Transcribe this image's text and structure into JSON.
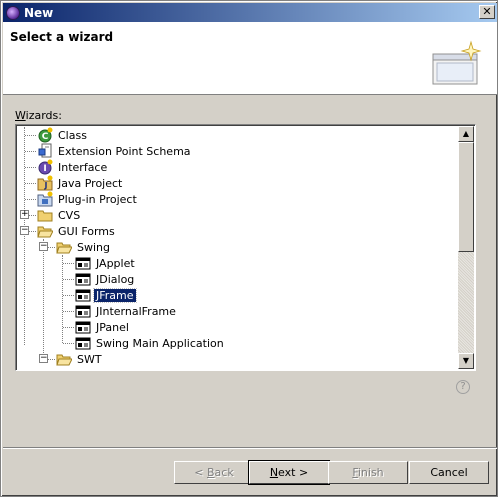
{
  "window": {
    "title": "New",
    "close_glyph": "✕"
  },
  "header": {
    "title": "Select a wizard"
  },
  "wizards_label": {
    "mnemonic": "W",
    "rest": "izards:"
  },
  "tree": [
    {
      "label": "Class",
      "icon": "class-icon",
      "selected": false
    },
    {
      "label": "Extension Point Schema",
      "icon": "extension-point-schema-icon",
      "selected": false
    },
    {
      "label": "Interface",
      "icon": "interface-icon",
      "selected": false
    },
    {
      "label": "Java Project",
      "icon": "java-project-icon",
      "selected": false
    },
    {
      "label": "Plug-in Project",
      "icon": "plugin-project-icon",
      "selected": false
    },
    {
      "label": "CVS",
      "icon": "folder-icon",
      "expander": "+",
      "selected": false
    },
    {
      "label": "GUI Forms",
      "icon": "folder-open-icon",
      "expander": "−",
      "selected": false
    },
    {
      "label": "Swing",
      "icon": "folder-open-icon",
      "expander": "−",
      "selected": false
    },
    {
      "label": "JApplet",
      "icon": "form-icon",
      "selected": false
    },
    {
      "label": "JDialog",
      "icon": "form-icon",
      "selected": false
    },
    {
      "label": "JFrame",
      "icon": "form-icon",
      "selected": true
    },
    {
      "label": "JInternalFrame",
      "icon": "form-icon",
      "selected": false
    },
    {
      "label": "JPanel",
      "icon": "form-icon",
      "selected": false
    },
    {
      "label": "Swing Main Application",
      "icon": "form-icon",
      "selected": false
    },
    {
      "label": "SWT",
      "icon": "folder-open-icon",
      "expander": "−",
      "selected": false
    }
  ],
  "scrollbar": {
    "up_glyph": "▲",
    "down_glyph": "▼"
  },
  "help": {
    "glyph": "?"
  },
  "buttons": {
    "back": {
      "prefix": "< ",
      "mnemonic": "B",
      "rest": "ack"
    },
    "next": {
      "mnemonic": "N",
      "rest": "ext >"
    },
    "finish": {
      "mnemonic": "F",
      "rest": "inish"
    },
    "cancel": {
      "label": "Cancel"
    }
  },
  "colors": {
    "titlebar_start": "#0a246a",
    "titlebar_end": "#a6caf0",
    "selection": "#0a246a",
    "face": "#d4d0c8"
  }
}
